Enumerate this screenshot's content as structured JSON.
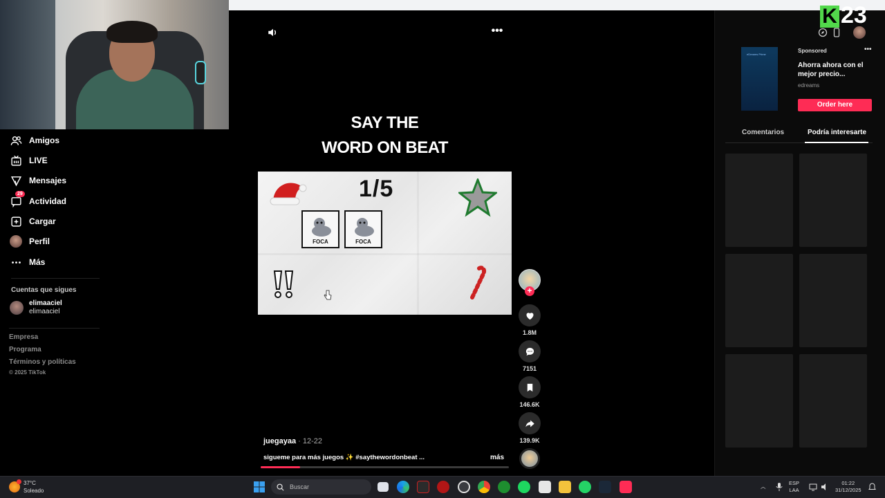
{
  "sidebar": {
    "items": [
      {
        "label": "Amigos",
        "icon": "friends-icon"
      },
      {
        "label": "LIVE",
        "icon": "live-icon"
      },
      {
        "label": "Mensajes",
        "icon": "messages-icon"
      },
      {
        "label": "Actividad",
        "icon": "activity-icon",
        "badge": "29"
      },
      {
        "label": "Cargar",
        "icon": "upload-icon"
      },
      {
        "label": "Perfil",
        "icon": "profile-avatar"
      },
      {
        "label": "Más",
        "icon": "more-icon"
      }
    ],
    "following_title": "Cuentas que sigues",
    "following": [
      {
        "name": "elimaaciel",
        "handle": "elimaaciel"
      }
    ],
    "footer": [
      "Empresa",
      "Programa",
      "Términos y políticas"
    ],
    "copyright": "© 2025 TikTok"
  },
  "video": {
    "title_line1": "SAY THE",
    "title_line2": "WORD ON BEAT",
    "round": "1/5",
    "cards": [
      {
        "label": "FOCA"
      },
      {
        "label": "FOCA"
      }
    ],
    "author": "juegayaa",
    "date": " · 12-22",
    "caption": "sigueme para más juegos ✨ #saythewordonbeat ...",
    "more_label": "más",
    "progress": 0.16
  },
  "actions": {
    "likes": "1.8M",
    "comments": "7151",
    "saves": "146.6K",
    "shares": "139.9K"
  },
  "ad": {
    "sponsored": "Sponsored",
    "title": "Ahorra ahora con el mejor precio...",
    "brand": "edreams",
    "thumb_text": "eDreams Prime",
    "cta": "Order here"
  },
  "tabs": {
    "comments": "Comentarios",
    "suggested": "Podría interesarte"
  },
  "overlay": {
    "logo_letter": "K",
    "logo_number": "23"
  },
  "taskbar": {
    "temp": "37°C",
    "weather": "Soleado",
    "search_placeholder": "Buscar",
    "lang1": "ESP",
    "lang2": "LAA",
    "time": "01:22",
    "date": "31/12/2025"
  },
  "colors": {
    "accent": "#fe2c55",
    "logo_green": "#52d84b",
    "background": "#000000"
  }
}
